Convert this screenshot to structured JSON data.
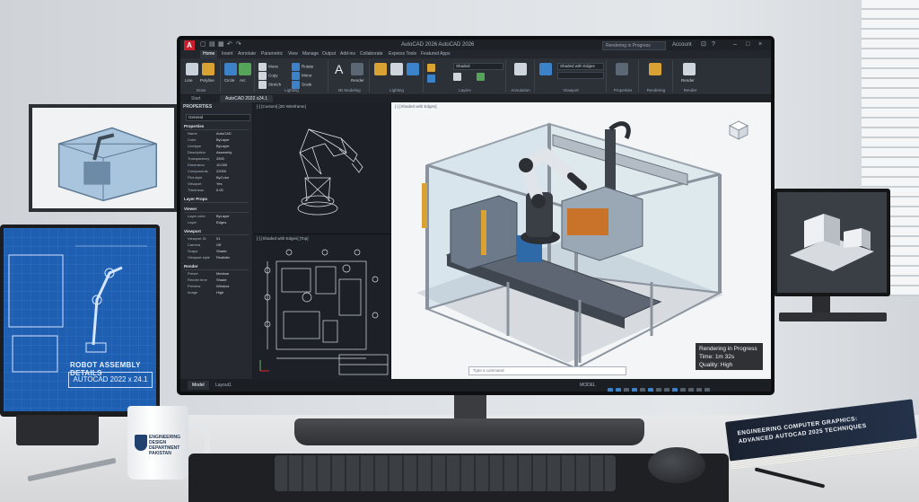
{
  "app": {
    "title": "AutoCAD 2026   AutoCAD 2026",
    "logo_letter": "A",
    "search_placeholder": "Rendering in Progress",
    "user": "Account",
    "accent": "#c8202e"
  },
  "menu_tabs": [
    "Home",
    "Insert",
    "Annotate",
    "Parametric",
    "View",
    "Manage",
    "Output",
    "Add-ins",
    "Collaborate",
    "Express Tools",
    "Featured Apps"
  ],
  "ribbon": {
    "draw": [
      "Line",
      "Polyline",
      "Circle",
      "Arc"
    ],
    "modify_labels": [
      "Move",
      "Copy",
      "Stretch",
      "Rotate",
      "Mirror",
      "Scale"
    ],
    "groups": [
      "Draw",
      "Modify",
      "Lighting",
      "3D Modeling",
      "Lighting",
      "Layers",
      "Annotation",
      "Viewport",
      "Properties",
      "Rendering",
      "Render"
    ],
    "layer_dropdown": "Shaded",
    "viewport_dropdown": "Shaded with Edges",
    "render_button": "Render",
    "render_button2": "Render"
  },
  "file_tabs": [
    "Start",
    "AutoCAD 2022 x24.1"
  ],
  "properties": {
    "title": "PROPERTIES",
    "selector": "General",
    "sections": [
      {
        "name": "Properties",
        "rows": [
          [
            "Name",
            "AutoCAD"
          ],
          [
            "Color",
            "ByLayer"
          ],
          [
            "Linetype",
            "ByLayer"
          ],
          [
            "Description",
            "Assembly"
          ],
          [
            "Transparency",
            "2500"
          ],
          [
            "Dimension",
            "10.000"
          ],
          [
            "Components",
            "22000"
          ],
          [
            "Plot style",
            "ByColor"
          ],
          [
            "Viewport",
            "Yes"
          ],
          [
            "Thickness",
            "0.00"
          ]
        ]
      },
      {
        "name": "Layer Props",
        "rows": []
      },
      {
        "name": "Viewer",
        "rows": [
          [
            "Layer color",
            "ByLayer"
          ],
          [
            "Layer",
            "Edges"
          ]
        ]
      },
      {
        "name": "Viewport",
        "rows": [
          [
            "Viewport ID",
            "01"
          ],
          [
            "Camera",
            "Off"
          ],
          [
            "Snaps",
            "Shade"
          ],
          [
            "Viewport style",
            "Realistic"
          ]
        ]
      },
      {
        "name": "Render",
        "rows": [
          [
            "Preset",
            "Medium"
          ],
          [
            "Render time",
            "Shade"
          ],
          [
            "Preview",
            "Window"
          ],
          [
            "Image",
            "High"
          ]
        ]
      }
    ]
  },
  "viewports": {
    "top_left_label": "[-] [Custom] [2D Wireframe]",
    "bottom_left_label": "[-] [Shaded with Edges] [Top]",
    "main_label": "[-] [Shaded with Edges]"
  },
  "render_status": {
    "line1": "Rendering in Progress",
    "line2": "Time: 1m 32s",
    "line3": "Quality: High"
  },
  "command_line": "Type a command",
  "status_tabs": [
    "Model",
    "Layout1"
  ],
  "status_mode": "MODEL",
  "left_monitor": {
    "title": "ROBOT ASSEMBLY DETAILS",
    "box": "AUTOCAD 2022 x 24.1"
  },
  "mug_text": "ENGINEERING DESIGN DEPARTMENT PAKISTAN",
  "book_title": "ENGINEERING COMPUTER GRAPHICS: ADVANCED AUTOCAD 2025 TECHNIQUES"
}
